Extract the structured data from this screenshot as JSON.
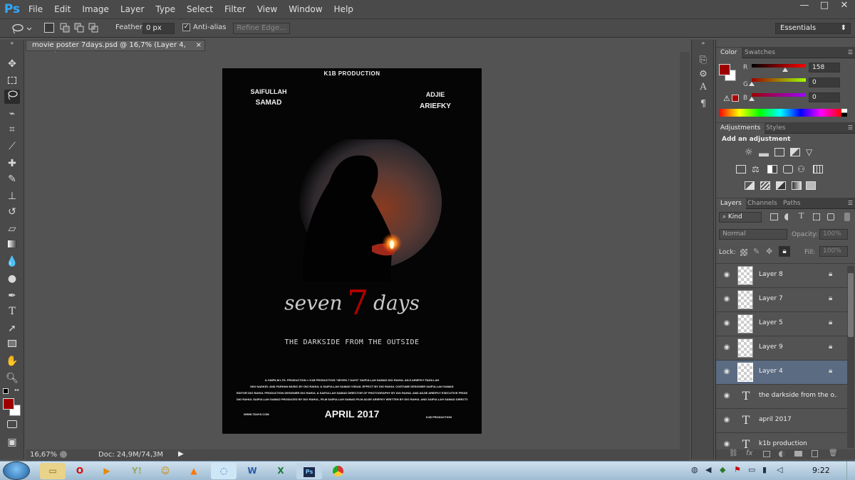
{
  "app": {
    "logo": "Ps"
  },
  "menu": {
    "items": [
      "File",
      "Edit",
      "Image",
      "Layer",
      "Type",
      "Select",
      "Filter",
      "View",
      "Window",
      "Help"
    ]
  },
  "window_controls": {
    "minimize": "—",
    "restore": "□",
    "close": "✕"
  },
  "options": {
    "feather_label": "Feather:",
    "feather_value": "0 px",
    "antialias_label": "Anti-alias",
    "refine_edge": "Refine Edge...",
    "workspace": "Essentials"
  },
  "document": {
    "tab_title": "movie poster 7days.psd @ 16,7% (Layer 4, RGB/8)",
    "close_glyph": "×",
    "zoom": "16,67%",
    "doc_size": "Doc: 24,9M/74,3M"
  },
  "poster": {
    "studio_top": "K1B PRODUCTION",
    "actor1_line1": "SAIFULLAH",
    "actor1_line2": "SAMAD",
    "actor2_line1": "ADJIE",
    "actor2_line2": "ARIEFKY",
    "title_left": "seven",
    "title_number": "7",
    "title_right": "days",
    "tagline": "THE DARKSIDE FROM THE OUTSIDE",
    "credits_1": "A ONIFILM LTD. PRODUCTION × K1B PRODUCTION \"SEVEN 7 DAYS\" SAIFULLAH SAMAD DIO RAHUL ADJI ARIEFKY FADILLAH",
    "credits_2": "DIKI NADKEL AND FARHAN MUSIC BY DIO RAHUL & SAIFULLAH SAMAD VISUAL EFFECT BY DIO RAHUL COSTUME DESIGNER SAIFULLAH SAMAD",
    "credits_3": "EDITOR DIO RAHUL PRODUCTION DESIGNER DIO RAHUL & SAIFULLAH SAMAD DIRECTOR OF PHOTOGRAPHY BY DIO RAHUL AND ADJIE ARIEFKY EXECUTIVE PRODUCER",
    "credits_4": "DIO RAHUL SAIFULLAH SAMAD PRODUCED BY DIO RAHUL, FILM SAIFULLAH SAMAD FILM ADJIE ARIEFKY WRITTEN BY DIO RAHUL AND SAIFULLAH SAMAD DIRECTED BY DIO RAHUL",
    "website": "WWW.7DAYS.COM",
    "date": "APRIL 2017",
    "studio_bottom": "K1B PRODUCTION"
  },
  "color_panel": {
    "tabs": [
      "Color",
      "Swatches"
    ],
    "r_label": "R",
    "r_value": "158",
    "r_level": 0.62,
    "g_label": "G",
    "g_value": "0",
    "g_level": 0,
    "b_label": "B",
    "b_value": "0",
    "b_level": 0,
    "foreground": "#9e0000",
    "background": "#ffffff"
  },
  "adjustments": {
    "tabs": [
      "Adjustments",
      "Styles"
    ],
    "heading": "Add an adjustment"
  },
  "layers_panel": {
    "tabs": [
      "Layers",
      "Channels",
      "Paths"
    ],
    "kind": "⌕ Kind",
    "blend_mode": "Normal",
    "opacity_label": "Opacity:",
    "opacity_value": "100%",
    "lock_label": "Lock:",
    "fill_label": "Fill:",
    "fill_value": "100%",
    "layers": [
      {
        "name": "Layer 8",
        "type": "pixel",
        "locked": true,
        "selected": false
      },
      {
        "name": "Layer 7",
        "type": "pixel",
        "locked": true,
        "selected": false
      },
      {
        "name": "Layer 5",
        "type": "pixel",
        "locked": true,
        "selected": false
      },
      {
        "name": "Layer 9",
        "type": "pixel",
        "locked": true,
        "selected": false
      },
      {
        "name": "Layer 4",
        "type": "pixel",
        "locked": true,
        "selected": true
      },
      {
        "name": "the darkside from the o...",
        "type": "text",
        "locked": false,
        "selected": false
      },
      {
        "name": "april 2017",
        "type": "text",
        "locked": false,
        "selected": false
      },
      {
        "name": "k1b production",
        "type": "text",
        "locked": false,
        "selected": false
      }
    ]
  },
  "taskbar": {
    "time": "9:22",
    "apps": [
      "folder",
      "opera",
      "media",
      "yahoo",
      "chat",
      "vlc",
      "swirl",
      "word",
      "excel",
      "photoshop",
      "chrome"
    ]
  }
}
